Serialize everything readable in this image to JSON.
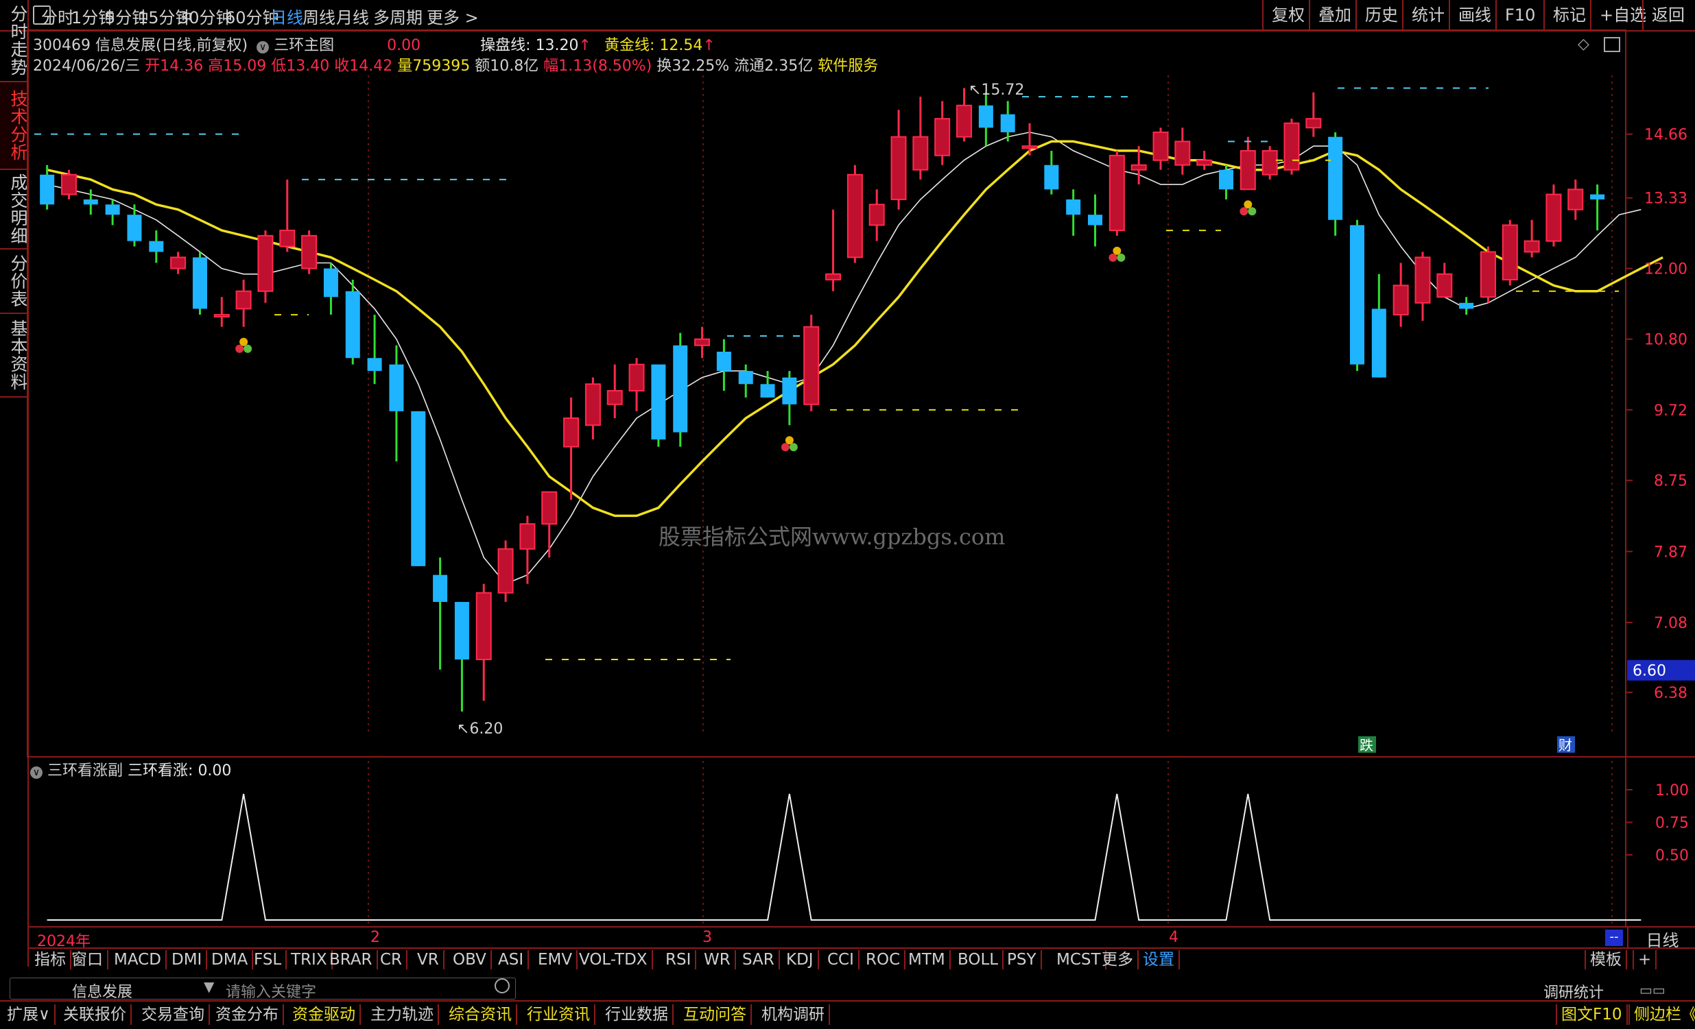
{
  "topbar": {
    "window_icon": "window-icon",
    "periods": [
      "分时",
      "1分钟",
      "5分钟",
      "15分钟",
      "30分钟",
      "60分钟",
      "日线",
      "周线",
      "月线",
      "多周期",
      "更多 >"
    ],
    "active_period": "日线",
    "right_buttons": [
      "复权",
      "叠加",
      "历史",
      "统计",
      "画线",
      "F10",
      "标记",
      "+自选",
      "返回"
    ]
  },
  "left_tabs": [
    "分时走势",
    "技术分析",
    "成交明细",
    "分价表",
    "基本资料"
  ],
  "left_active": "技术分析",
  "stock": {
    "code_name": "300469 信息发展(日线,前复权)",
    "indicator_name": "三环主图",
    "indicator_value": "0.00",
    "line1_label": "操盘线:",
    "line1_value": "13.20",
    "line2_label": "黄金线:",
    "line2_value": "12.54",
    "date": "2024/06/26/三",
    "open_label": "开",
    "open": "14.36",
    "high_label": "高",
    "high": "15.09",
    "low_label": "低",
    "low": "13.40",
    "close_label": "收",
    "close": "14.42",
    "vol_label": "量",
    "vol": "759395",
    "amt_label": "额",
    "amt": "10.8亿",
    "chg_label": "幅",
    "chg": "1.13(8.50%)",
    "turn_label": "换",
    "turn": "32.25%",
    "float_label": "流通",
    "float": "2.35亿",
    "sector": "软件服务"
  },
  "watermark": "股票指标公式网www.gpzbgs.com",
  "markers": {
    "high_label": "15.72",
    "low_label": "6.20",
    "event1": "跌",
    "event2": "财",
    "current_price": "6.60"
  },
  "sub_panel": {
    "title": "三环看涨副",
    "series_label": "三环看涨:",
    "value": "0.00",
    "ticks": [
      "1.00",
      "0.75",
      "0.50"
    ]
  },
  "time_axis": {
    "year": "2024年",
    "months": [
      "2",
      "3",
      "4"
    ],
    "end_marker": "--",
    "period": "日线"
  },
  "indicator_tabs": [
    "指标",
    "窗口",
    "MACD",
    "DMI",
    "DMA",
    "FSL",
    "TRIX",
    "BRAR",
    "CR",
    "VR",
    "OBV",
    "ASI",
    "EMV",
    "VOL-TDX",
    "RSI",
    "WR",
    "SAR",
    "KDJ",
    "CCI",
    "ROC",
    "MTM",
    "BOLL",
    "PSY",
    "MCST",
    "更多",
    "设置"
  ],
  "indicator_right": [
    "模板",
    "+"
  ],
  "search": {
    "stock_name": "信息发展",
    "placeholder": "请输入关键字",
    "right_label": "调研统计"
  },
  "bottom_tabs": [
    "扩展∨",
    "关联报价",
    "交易查询",
    "资金分布",
    "资金驱动",
    "主力轨迹",
    "综合资讯",
    "行业资讯",
    "行业数据",
    "互动问答",
    "机构调研"
  ],
  "bottom_right": [
    "图文F10",
    "侧边栏《"
  ],
  "colors": {
    "up": "#ff2a4a",
    "down": "#1eb4ff",
    "ma_fast": "#e8e8e8",
    "ma_slow": "#f0e020",
    "grid": "#8b1a1a",
    "dash_cyan": "#4fd0f0",
    "dash_yellow": "#e8e000"
  },
  "chart_data": {
    "type": "candlestick",
    "price_axis": {
      "ticks": [
        14.66,
        13.33,
        12.0,
        10.8,
        9.72,
        8.75,
        7.87,
        7.08,
        6.38
      ],
      "range": [
        6.0,
        16.0
      ],
      "scale": "log"
    },
    "candles": [
      {
        "o": 13.8,
        "h": 14.0,
        "l": 13.1,
        "c": 13.2
      },
      {
        "o": 13.4,
        "h": 13.9,
        "l": 13.3,
        "c": 13.8
      },
      {
        "o": 13.3,
        "h": 13.5,
        "l": 13.0,
        "c": 13.2
      },
      {
        "o": 13.2,
        "h": 13.3,
        "l": 12.8,
        "c": 13.0
      },
      {
        "o": 13.0,
        "h": 13.2,
        "l": 12.4,
        "c": 12.5
      },
      {
        "o": 12.5,
        "h": 12.7,
        "l": 12.1,
        "c": 12.3
      },
      {
        "o": 12.0,
        "h": 12.3,
        "l": 11.9,
        "c": 12.2
      },
      {
        "o": 12.2,
        "h": 12.3,
        "l": 11.2,
        "c": 11.3
      },
      {
        "o": 11.2,
        "h": 11.5,
        "l": 11.0,
        "c": 11.2
      },
      {
        "o": 11.3,
        "h": 11.8,
        "l": 11.0,
        "c": 11.6
      },
      {
        "o": 11.6,
        "h": 12.7,
        "l": 11.4,
        "c": 12.6
      },
      {
        "o": 12.4,
        "h": 13.7,
        "l": 12.3,
        "c": 12.7
      },
      {
        "o": 12.0,
        "h": 12.7,
        "l": 11.9,
        "c": 12.6
      },
      {
        "o": 12.0,
        "h": 12.1,
        "l": 11.2,
        "c": 11.5
      },
      {
        "o": 11.6,
        "h": 11.8,
        "l": 10.4,
        "c": 10.5
      },
      {
        "o": 10.5,
        "h": 11.2,
        "l": 10.1,
        "c": 10.3
      },
      {
        "o": 10.4,
        "h": 10.7,
        "l": 9.0,
        "c": 9.7
      },
      {
        "o": 9.7,
        "h": 9.7,
        "l": 7.7,
        "c": 7.7
      },
      {
        "o": 7.6,
        "h": 7.8,
        "l": 6.6,
        "c": 7.3
      },
      {
        "o": 7.3,
        "h": 7.3,
        "l": 6.2,
        "c": 6.7
      },
      {
        "o": 6.7,
        "h": 7.5,
        "l": 6.3,
        "c": 7.4
      },
      {
        "o": 7.4,
        "h": 8.0,
        "l": 7.3,
        "c": 7.9
      },
      {
        "o": 7.9,
        "h": 8.3,
        "l": 7.5,
        "c": 8.2
      },
      {
        "o": 8.2,
        "h": 8.6,
        "l": 7.8,
        "c": 8.6
      },
      {
        "o": 9.2,
        "h": 9.9,
        "l": 8.5,
        "c": 9.6
      },
      {
        "o": 9.5,
        "h": 10.2,
        "l": 9.3,
        "c": 10.1
      },
      {
        "o": 9.8,
        "h": 10.4,
        "l": 9.6,
        "c": 10.0
      },
      {
        "o": 10.0,
        "h": 10.5,
        "l": 9.7,
        "c": 10.4
      },
      {
        "o": 10.4,
        "h": 10.4,
        "l": 9.2,
        "c": 9.3
      },
      {
        "o": 10.7,
        "h": 10.9,
        "l": 9.2,
        "c": 9.4
      },
      {
        "o": 10.7,
        "h": 11.0,
        "l": 10.5,
        "c": 10.8
      },
      {
        "o": 10.6,
        "h": 10.8,
        "l": 10.0,
        "c": 10.3
      },
      {
        "o": 10.3,
        "h": 10.4,
        "l": 9.9,
        "c": 10.1
      },
      {
        "o": 10.1,
        "h": 10.3,
        "l": 9.9,
        "c": 9.9
      },
      {
        "o": 10.2,
        "h": 10.3,
        "l": 9.5,
        "c": 9.8
      },
      {
        "o": 9.8,
        "h": 11.2,
        "l": 9.7,
        "c": 11.0
      },
      {
        "o": 11.8,
        "h": 13.1,
        "l": 11.6,
        "c": 11.9
      },
      {
        "o": 12.2,
        "h": 14.0,
        "l": 12.1,
        "c": 13.8
      },
      {
        "o": 12.8,
        "h": 13.5,
        "l": 12.5,
        "c": 13.2
      },
      {
        "o": 13.3,
        "h": 15.2,
        "l": 13.1,
        "c": 14.6
      },
      {
        "o": 13.9,
        "h": 15.5,
        "l": 13.7,
        "c": 14.6
      },
      {
        "o": 14.2,
        "h": 15.4,
        "l": 14.0,
        "c": 15.0
      },
      {
        "o": 14.6,
        "h": 15.7,
        "l": 14.5,
        "c": 15.3
      },
      {
        "o": 15.3,
        "h": 15.6,
        "l": 14.4,
        "c": 14.8
      },
      {
        "o": 15.1,
        "h": 15.4,
        "l": 14.5,
        "c": 14.7
      },
      {
        "o": 14.4,
        "h": 14.9,
        "l": 14.2,
        "c": 14.4
      },
      {
        "o": 14.0,
        "h": 14.3,
        "l": 13.4,
        "c": 13.5
      },
      {
        "o": 13.3,
        "h": 13.5,
        "l": 12.6,
        "c": 13.0
      },
      {
        "o": 13.0,
        "h": 13.4,
        "l": 12.4,
        "c": 12.8
      },
      {
        "o": 12.7,
        "h": 14.3,
        "l": 12.6,
        "c": 14.2
      },
      {
        "o": 13.9,
        "h": 14.4,
        "l": 13.6,
        "c": 14.0
      },
      {
        "o": 14.1,
        "h": 14.8,
        "l": 13.9,
        "c": 14.7
      },
      {
        "o": 14.0,
        "h": 14.8,
        "l": 13.8,
        "c": 14.5
      },
      {
        "o": 14.0,
        "h": 14.3,
        "l": 13.9,
        "c": 14.1
      },
      {
        "o": 13.9,
        "h": 14.0,
        "l": 13.3,
        "c": 13.5
      },
      {
        "o": 13.5,
        "h": 14.6,
        "l": 13.5,
        "c": 14.3
      },
      {
        "o": 13.8,
        "h": 14.4,
        "l": 13.7,
        "c": 14.3
      },
      {
        "o": 13.9,
        "h": 15.0,
        "l": 13.8,
        "c": 14.9
      },
      {
        "o": 14.8,
        "h": 15.6,
        "l": 14.6,
        "c": 15.0
      },
      {
        "o": 14.6,
        "h": 14.7,
        "l": 12.6,
        "c": 12.9
      },
      {
        "o": 12.8,
        "h": 12.9,
        "l": 10.3,
        "c": 10.4
      },
      {
        "o": 11.3,
        "h": 11.9,
        "l": 10.2,
        "c": 10.2
      },
      {
        "o": 11.2,
        "h": 12.1,
        "l": 11.0,
        "c": 11.7
      },
      {
        "o": 11.4,
        "h": 12.3,
        "l": 11.1,
        "c": 12.2
      },
      {
        "o": 11.5,
        "h": 12.1,
        "l": 11.5,
        "c": 11.9
      },
      {
        "o": 11.4,
        "h": 11.5,
        "l": 11.2,
        "c": 11.3
      },
      {
        "o": 11.5,
        "h": 12.4,
        "l": 11.4,
        "c": 12.3
      },
      {
        "o": 11.8,
        "h": 12.9,
        "l": 11.7,
        "c": 12.8
      },
      {
        "o": 12.3,
        "h": 12.9,
        "l": 12.2,
        "c": 12.5
      },
      {
        "o": 12.5,
        "h": 13.6,
        "l": 12.4,
        "c": 13.4
      },
      {
        "o": 13.1,
        "h": 13.7,
        "l": 12.9,
        "c": 13.5
      },
      {
        "o": 13.4,
        "h": 13.6,
        "l": 12.7,
        "c": 13.3
      }
    ],
    "ma_fast": [
      13.6,
      13.5,
      13.4,
      13.3,
      13.1,
      12.9,
      12.6,
      12.3,
      12.0,
      11.9,
      11.9,
      12.0,
      12.1,
      12.1,
      11.7,
      11.3,
      10.8,
      10.1,
      9.3,
      8.5,
      7.8,
      7.5,
      7.6,
      7.9,
      8.3,
      8.8,
      9.2,
      9.6,
      9.8,
      10.0,
      10.2,
      10.3,
      10.3,
      10.2,
      10.1,
      10.2,
      10.7,
      11.4,
      12.1,
      12.8,
      13.3,
      13.7,
      14.1,
      14.4,
      14.6,
      14.7,
      14.6,
      14.3,
      14.1,
      13.9,
      13.8,
      13.6,
      13.6,
      13.8,
      13.9,
      14.0,
      14.0,
      14.1,
      14.4,
      14.4,
      14.0,
      13.0,
      12.4,
      11.9,
      11.5,
      11.3,
      11.4,
      11.6,
      11.8,
      12.0,
      12.2,
      12.6,
      13.0,
      13.1
    ],
    "ma_slow": [
      13.9,
      13.8,
      13.7,
      13.5,
      13.4,
      13.2,
      13.1,
      12.9,
      12.7,
      12.6,
      12.5,
      12.4,
      12.3,
      12.2,
      12.0,
      11.8,
      11.6,
      11.3,
      11.0,
      10.6,
      10.1,
      9.6,
      9.2,
      8.8,
      8.6,
      8.4,
      8.3,
      8.3,
      8.4,
      8.7,
      9.0,
      9.3,
      9.6,
      9.8,
      10.0,
      10.2,
      10.4,
      10.7,
      11.1,
      11.5,
      12.0,
      12.5,
      13.0,
      13.5,
      13.9,
      14.3,
      14.5,
      14.5,
      14.4,
      14.3,
      14.3,
      14.2,
      14.1,
      14.1,
      14.0,
      13.9,
      13.9,
      14.0,
      14.1,
      14.3,
      14.2,
      13.9,
      13.5,
      13.2,
      12.9,
      12.6,
      12.3,
      12.1,
      11.9,
      11.7,
      11.6,
      11.6,
      11.8,
      12.0,
      12.2
    ],
    "signal_sub": [
      0,
      0,
      0,
      0,
      0,
      0,
      0,
      0,
      0,
      1,
      0,
      0,
      0,
      0,
      0,
      0,
      0,
      0,
      0,
      0,
      0,
      0,
      0,
      0,
      0,
      0,
      0,
      0,
      0,
      0,
      0,
      0,
      0,
      0,
      1,
      0,
      0,
      0,
      0,
      0,
      0,
      0,
      0,
      0,
      0,
      0,
      0,
      0,
      0,
      1,
      0,
      0,
      0,
      0,
      0,
      1,
      0,
      0,
      0,
      0,
      0,
      0,
      0,
      0,
      0,
      0,
      0,
      0,
      0,
      0,
      0,
      0,
      0,
      0
    ],
    "sub_axis": {
      "range": [
        0,
        1.2
      ]
    }
  }
}
